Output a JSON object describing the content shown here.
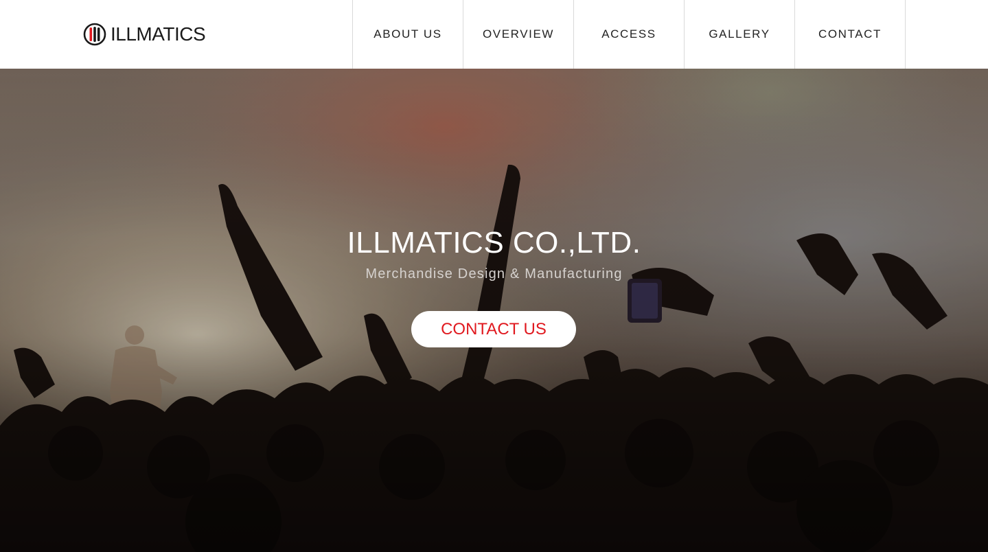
{
  "header": {
    "logo_text": "ILLMATICS",
    "nav": [
      {
        "label": "ABOUT US"
      },
      {
        "label": "OVERVIEW"
      },
      {
        "label": "ACCESS"
      },
      {
        "label": "GALLERY"
      },
      {
        "label": "CONTACT"
      }
    ]
  },
  "hero": {
    "title": "ILLMATICS CO.,LTD.",
    "subtitle": "Merchandise Design & Manufacturing",
    "cta_label": "CONTACT US",
    "background_icon": "concert-crowd-photo"
  },
  "colors": {
    "accent": "#e0191f",
    "text_dark": "#222222",
    "nav_divider": "#d9d9d9"
  }
}
